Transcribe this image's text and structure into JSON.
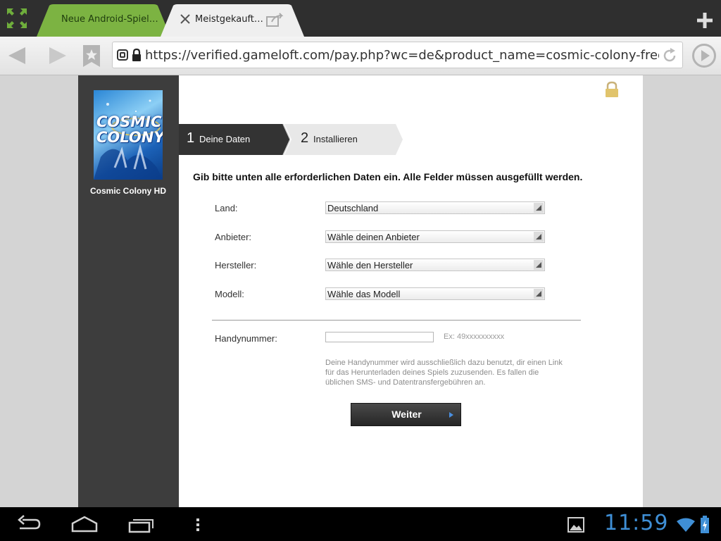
{
  "browser": {
    "tabs": [
      {
        "label": "Neue Android-Spiel…",
        "active": false,
        "color": "#7cb342"
      },
      {
        "label": "Meistgekauft…",
        "active": true,
        "color": "#efefef"
      }
    ],
    "url": "https://verified.gameloft.com/pay.php?wc=de&product_name=cosmic-colony-free&platfo…",
    "icons": {
      "expand": "expand-icon",
      "new_tab": "plus-icon",
      "back": "back-arrow-icon",
      "forward": "forward-arrow-icon",
      "bookmark": "bookmark-star-icon",
      "reload": "reload-icon",
      "go": "play-icon",
      "close": "close-icon",
      "share": "share-icon"
    }
  },
  "sidebar": {
    "cover_text": "COSMIC COLONY",
    "game_title": "Cosmic Colony HD"
  },
  "steps": [
    {
      "number": "1",
      "label": "Deine Daten",
      "active": true
    },
    {
      "number": "2",
      "label": "Installieren",
      "active": false
    }
  ],
  "form": {
    "instructions": "Gib bitte unten alle erforderlichen Daten ein. Alle Felder müssen ausgefüllt werden.",
    "fields": [
      {
        "label": "Land:",
        "value": "Deutschland"
      },
      {
        "label": "Anbieter:",
        "value": "Wähle deinen Anbieter"
      },
      {
        "label": "Hersteller:",
        "value": "Wähle den Hersteller"
      },
      {
        "label": "Modell:",
        "value": "Wähle das Modell"
      }
    ],
    "phone": {
      "label": "Handynummer:",
      "value": "",
      "example": "Ex: 49xxxxxxxxxx",
      "help_lines": [
        "Deine Handynummer wird ausschließlich dazu benutzt, dir einen Link",
        "für das Herunterladen deines Spiels zuzusenden. Es fallen die",
        "üblichen SMS- und Datentransfergebühren an."
      ]
    },
    "submit_label": "Weiter"
  },
  "system_bar": {
    "clock": "11:59",
    "accent_color": "#3f8fd6"
  }
}
